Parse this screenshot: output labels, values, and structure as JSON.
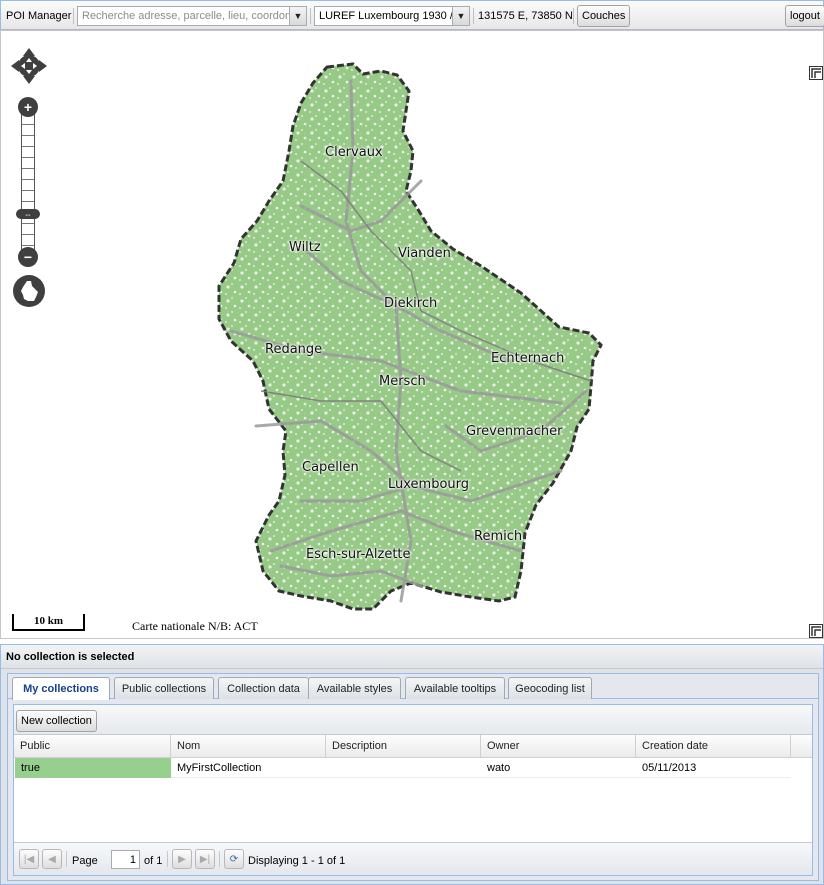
{
  "toolbar": {
    "app_title": "POI Manager",
    "search": {
      "placeholder": "Recherche adresse, parcelle, lieu, coordon",
      "value": ""
    },
    "projection": {
      "selected": "LUREF Luxembourg 1930 /"
    },
    "coordinates": "131575 E, 73850 N",
    "layers_label": "Couches",
    "logout_label": "logout"
  },
  "map": {
    "scale_label": "10 km",
    "attribution": "Carte nationale N/B: ACT",
    "cities": [
      "Clervaux",
      "Wiltz",
      "Vianden",
      "Diekirch",
      "Redange",
      "Echternach",
      "Mersch",
      "Grevenmacher",
      "Capellen",
      "Luxembourg",
      "Remich",
      "Esch-sur-Alzette"
    ],
    "colors": {
      "land": "#97c987",
      "border": "#333333",
      "roads": "#9a9a9a"
    }
  },
  "panel": {
    "status": "No collection is selected",
    "tabs": [
      "My collections",
      "Public collections",
      "Collection data",
      "Available styles",
      "Available tooltips",
      "Geocoding list"
    ],
    "active_tab": "My collections",
    "new_collection_label": "New collection",
    "columns": [
      "Public",
      "Nom",
      "Description",
      "Owner",
      "Creation date"
    ],
    "rows": [
      {
        "public": "true",
        "nom": "MyFirstCollection",
        "description": "",
        "owner": "wato",
        "creation_date": "05/11/2013"
      }
    ],
    "paging": {
      "page_label": "Page",
      "page_value": "1",
      "of_label": "of 1",
      "display_text": "Displaying 1 - 1 of 1"
    },
    "colors": {
      "public_true": "#97d08e",
      "accent": "#99bbe8"
    }
  }
}
